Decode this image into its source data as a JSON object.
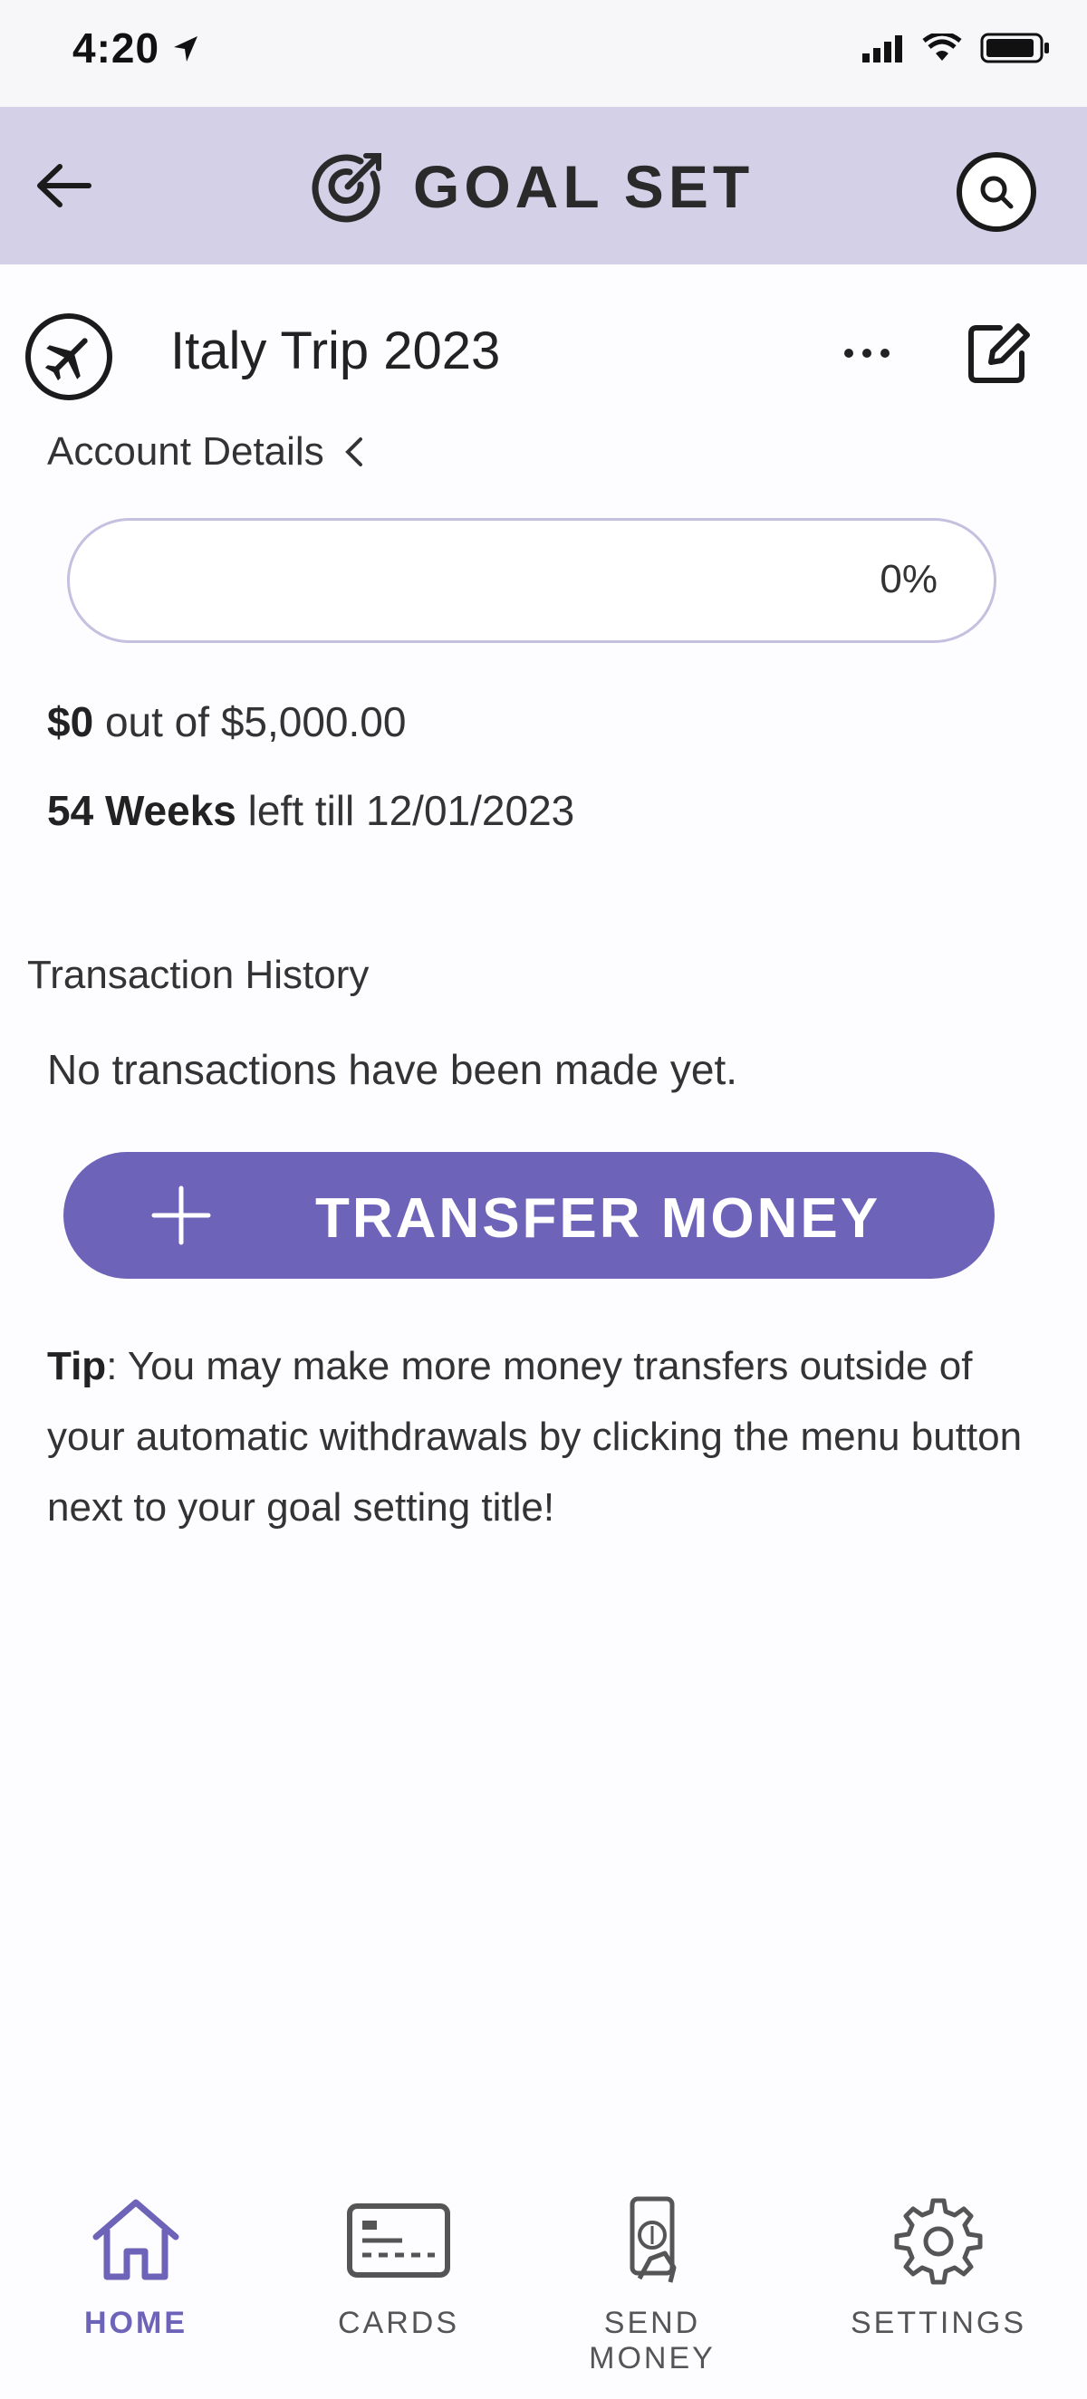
{
  "status_bar": {
    "time": "4:20"
  },
  "header": {
    "title": "GOAL SET"
  },
  "goal": {
    "title": "Italy Trip 2023",
    "account_details_label": "Account Details",
    "progress_percent": 0,
    "progress_text": "0%",
    "saved_amount": "$0",
    "amount_rest": " out of $5,000.00",
    "weeks_left": "54 Weeks",
    "weeks_rest": " left till 12/01/2023"
  },
  "transactions": {
    "section_title": "Transaction History",
    "empty_message": "No transactions have been made yet."
  },
  "transfer_button": {
    "label": "TRANSFER MONEY"
  },
  "tip": {
    "label": "Tip",
    "text": ": You may make more money transfers outside of your automatic withdrawals by clicking the menu button next to your goal setting title!"
  },
  "tabbar": {
    "active_color": "#6d63b8",
    "items": [
      {
        "label": "HOME",
        "icon": "home-icon",
        "active": true
      },
      {
        "label": "CARDS",
        "icon": "card-icon",
        "active": false
      },
      {
        "label": "SEND MONEY",
        "icon": "send-money-icon",
        "active": false
      },
      {
        "label": "SETTINGS",
        "icon": "gear-icon",
        "active": false
      }
    ]
  },
  "colors": {
    "header_bg": "#d3d0e8",
    "accent": "#6d63b8"
  }
}
